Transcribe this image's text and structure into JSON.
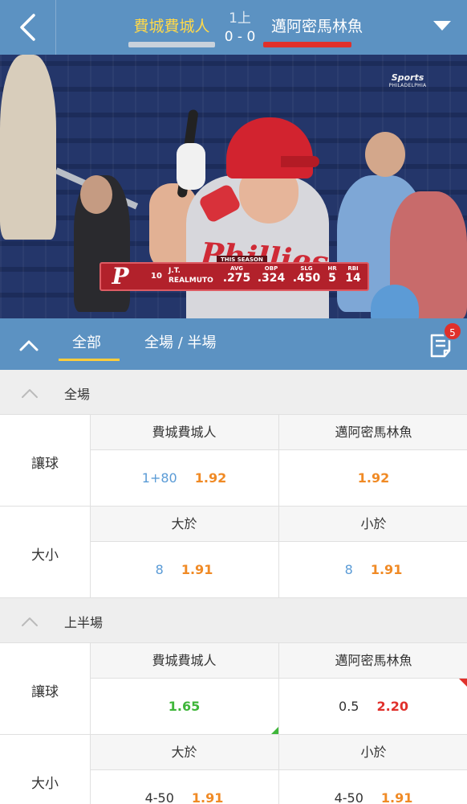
{
  "header": {
    "home_team": "費城費城人",
    "away_team": "邁阿密馬林魚",
    "inning": "1上",
    "score": "0 - 0",
    "home_color": "#ffd94a",
    "away_color": "#e0302b"
  },
  "video": {
    "broadcaster_line1": "Sports",
    "broadcaster_line2": "PHILADELPHIA",
    "jersey_text": "Phillies",
    "stat_banner": {
      "season_label": "THIS SEASON",
      "team_logo": "P",
      "number": "10",
      "first_name": "J.T.",
      "last_name": "REALMUTO",
      "stats": [
        {
          "label": "AVG",
          "value": ".275"
        },
        {
          "label": "OBP",
          "value": ".324"
        },
        {
          "label": "SLG",
          "value": ".450"
        },
        {
          "label": "HR",
          "value": "5"
        },
        {
          "label": "RBI",
          "value": "14"
        }
      ]
    }
  },
  "tabs": {
    "all": "全部",
    "full_half": "全場 / 半場",
    "betslip_badge": "5"
  },
  "sections": [
    {
      "title": "全場",
      "markets": [
        {
          "label": "讓球",
          "left_header": "費城費城人",
          "right_header": "邁阿密馬林魚",
          "left_line": "1+80",
          "left_odds": "1.92",
          "right_line": "",
          "right_odds": "1.92"
        },
        {
          "label": "大小",
          "left_header": "大於",
          "right_header": "小於",
          "left_line": "8",
          "left_odds": "1.91",
          "right_line": "8",
          "right_odds": "1.91"
        }
      ]
    },
    {
      "title": "上半場",
      "markets": [
        {
          "label": "讓球",
          "left_header": "費城費城人",
          "right_header": "邁阿密馬林魚",
          "left_line": "",
          "left_odds": "1.65",
          "right_line": "0.5",
          "right_odds": "2.20"
        },
        {
          "label": "大小",
          "left_header": "大於",
          "right_header": "小於",
          "left_line": "4-50",
          "left_odds": "1.91",
          "right_line": "4-50",
          "right_odds": "1.91"
        }
      ]
    }
  ]
}
